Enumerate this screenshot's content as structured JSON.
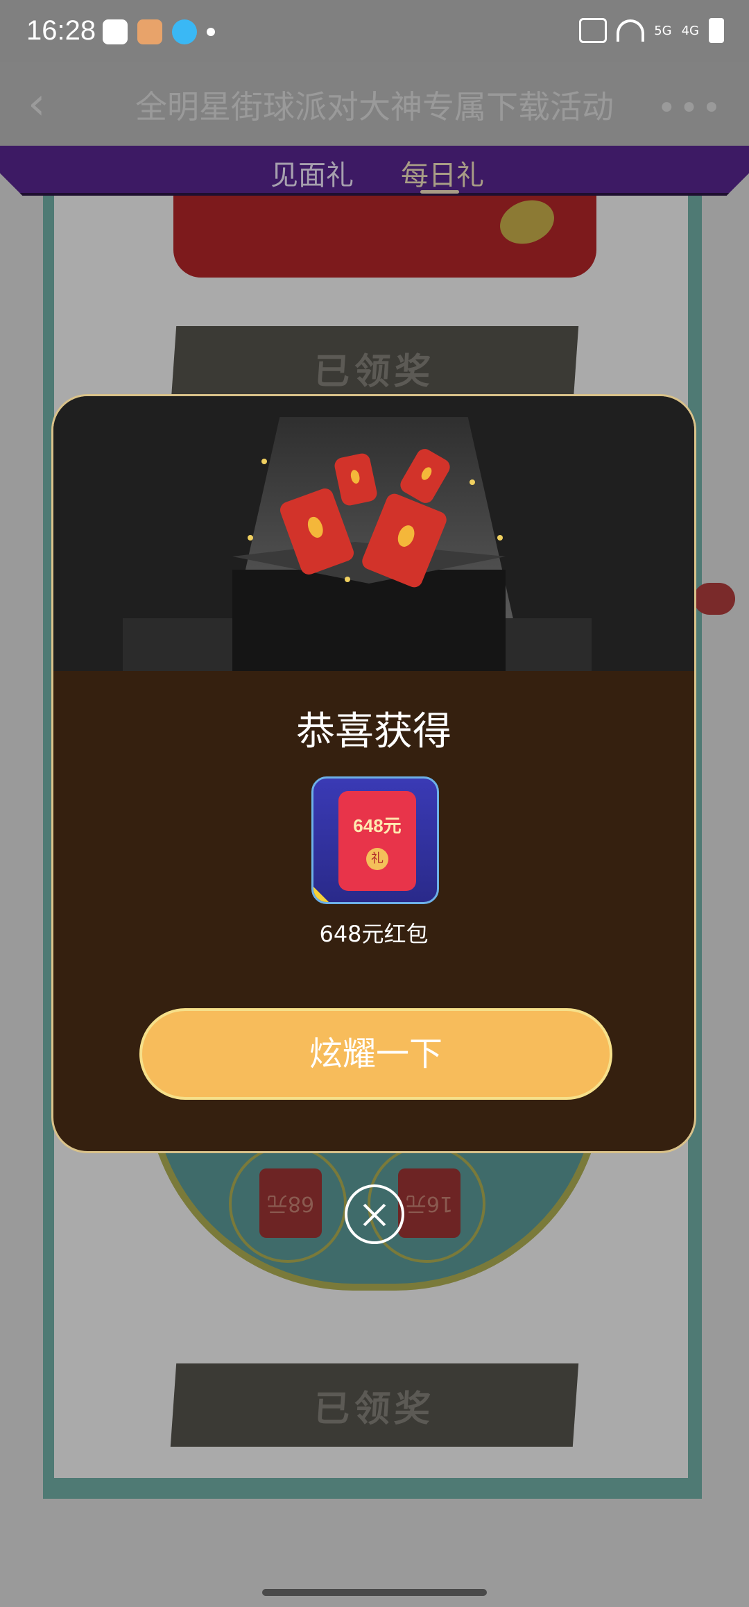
{
  "status_bar": {
    "time": "16:28",
    "left_icons": [
      "gallery-icon",
      "app-notification-icon",
      "qq-icon",
      "dot-icon"
    ],
    "right_icons": [
      "sms-icon",
      "wifi-6-icon",
      "signal-5g-icon",
      "signal-4g-icon",
      "battery-icon"
    ],
    "net_5g": "5G",
    "net_4g": "4G"
  },
  "navbar": {
    "title": "全明星街球派对大神专属下载活动",
    "back_icon": "chevron-left-icon",
    "more_icon": "more-dots-icon"
  },
  "tabs": [
    {
      "label": "见面礼"
    },
    {
      "label": "每日礼",
      "active": true
    }
  ],
  "background": {
    "stamp_text": "已领奖",
    "slot_labels": [
      "68元",
      "16元"
    ]
  },
  "modal": {
    "title": "恭喜获得",
    "prize": {
      "amount_label": "648元",
      "coin_label": "礼",
      "name": "648元红包"
    },
    "button_label": "炫耀一下",
    "close_icon": "close-circle-icon"
  },
  "colors": {
    "modal_bg": "#35200f",
    "button_bg": "#f7bc5b",
    "tab_bar": "#3d1a64"
  }
}
